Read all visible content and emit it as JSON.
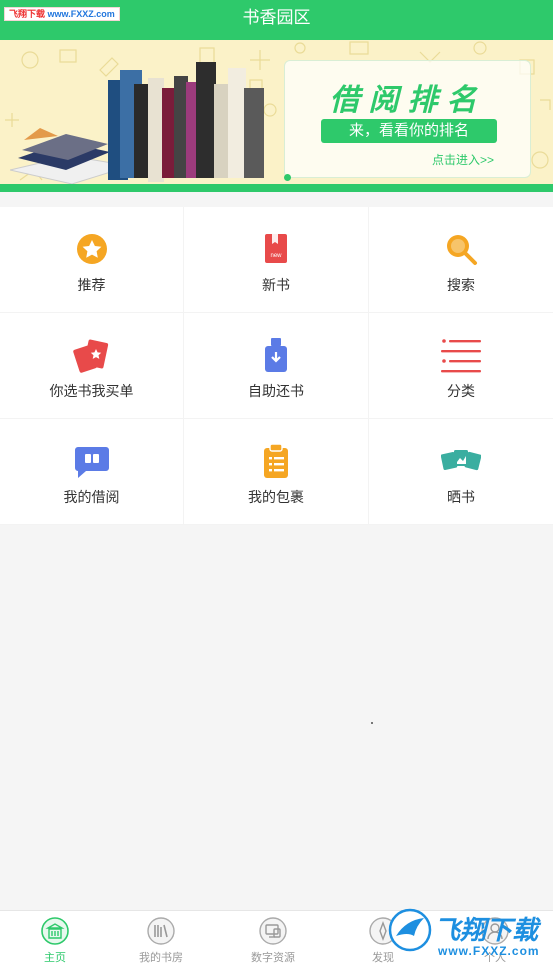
{
  "watermark": {
    "site_cn": "飞翔下载",
    "site_url": "www.FXXZ.com",
    "logo_cn": "飞翔下载",
    "logo_url": "www.FXXZ.com"
  },
  "header": {
    "title": "书香园区"
  },
  "banner": {
    "headline": "借阅排名",
    "subline": "来，看看你的排名",
    "enter_link": "点击进入>>"
  },
  "menu": [
    {
      "label": "推荐",
      "icon": "star-icon",
      "color": "#f5a623"
    },
    {
      "label": "新书",
      "icon": "new-book-icon",
      "color": "#e84a4a"
    },
    {
      "label": "搜索",
      "icon": "search-icon",
      "color": "#f5a623"
    },
    {
      "label": "你选书我买单",
      "icon": "cards-icon",
      "color": "#e84a4a"
    },
    {
      "label": "自助还书",
      "icon": "return-book-icon",
      "color": "#5b7be6"
    },
    {
      "label": "分类",
      "icon": "list-icon",
      "color": "#e84a4a"
    },
    {
      "label": "我的借阅",
      "icon": "borrow-chat-icon",
      "color": "#5b7be6"
    },
    {
      "label": "我的包裹",
      "icon": "clipboard-icon",
      "color": "#f5a623"
    },
    {
      "label": "晒书",
      "icon": "photos-icon",
      "color": "#3aaea0"
    }
  ],
  "bottom_nav": [
    {
      "label": "主页",
      "icon": "home-icon",
      "active": true
    },
    {
      "label": "我的书房",
      "icon": "bookshelf-icon",
      "active": false
    },
    {
      "label": "数字资源",
      "icon": "digital-resource-icon",
      "active": false
    },
    {
      "label": "发现",
      "icon": "compass-icon",
      "active": false
    },
    {
      "label": "个人",
      "icon": "user-icon",
      "active": false
    }
  ],
  "colors": {
    "brand": "#2ec96b",
    "banner_bg": "#fbf2c8"
  }
}
